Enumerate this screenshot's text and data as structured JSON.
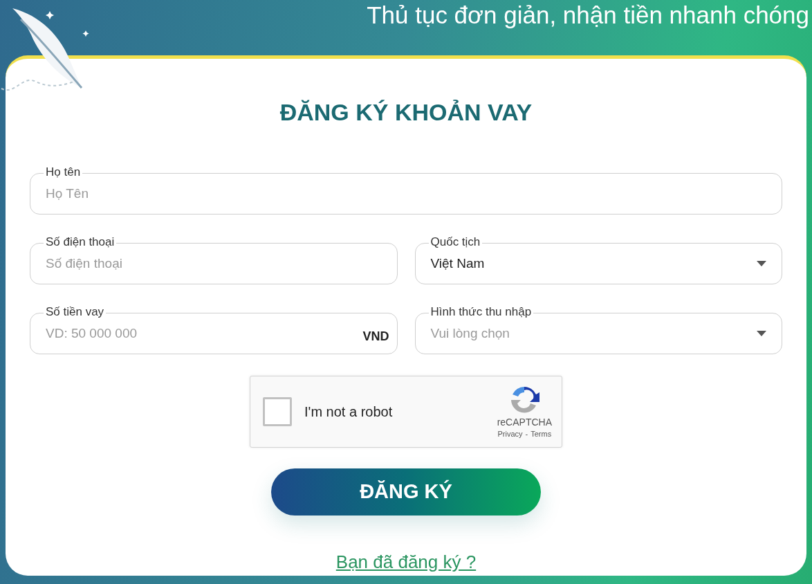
{
  "header": {
    "tagline": "Thủ tục đơn giản, nhận tiền nhanh chóng"
  },
  "form": {
    "title": "ĐĂNG KÝ KHOẢN VAY",
    "rows": [
      [
        {
          "kind": "text",
          "label": "Họ tên",
          "placeholder": "Họ Tên"
        }
      ],
      [
        {
          "kind": "text",
          "label": "Số điện thoại",
          "placeholder": "Số điện thoại"
        },
        {
          "kind": "select",
          "label": "Quốc tịch",
          "value": "Việt Nam"
        }
      ],
      [
        {
          "kind": "text",
          "label": "Số tiền vay",
          "placeholder": "VD: 50 000 000",
          "suffix": "VND"
        },
        {
          "kind": "select",
          "label": "Hình thức thu nhập",
          "placeholder": "Vui lòng chọn"
        }
      ]
    ],
    "captcha": {
      "checked": false,
      "label": "I'm not a robot",
      "brand": "reCAPTCHA",
      "privacy": "Privacy",
      "separator": "-",
      "terms": "Terms"
    },
    "submit": "ĐĂNG KÝ",
    "link": "Bạn đã đăng ký ?"
  }
}
